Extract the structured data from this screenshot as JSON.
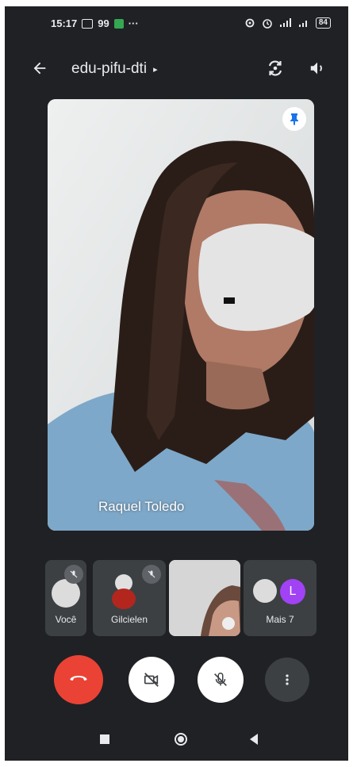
{
  "status_bar": {
    "time": "15:17",
    "notification_count": "99",
    "more_dots": "···",
    "battery": "84"
  },
  "top_bar": {
    "meeting_code": "edu-pifu-dti",
    "title_arrow": "▸"
  },
  "main_video": {
    "participant_name": "Raquel Toledo"
  },
  "thumbnails": [
    {
      "label": "Você"
    },
    {
      "label": "Gilcielen"
    },
    {
      "label": ""
    },
    {
      "label": "Mais 7",
      "avatar_letter": "L"
    }
  ],
  "controls": {
    "end_call_icon": "phone-hangup-icon",
    "camera_icon": "video-off-icon",
    "mic_icon": "mic-off-icon",
    "more_icon": "more-vertical-icon",
    "end_call_color": "#ea4335"
  },
  "nav_bar": {
    "recents_icon": "square-icon",
    "home_icon": "circle-icon",
    "back_icon": "triangle-back-icon"
  }
}
